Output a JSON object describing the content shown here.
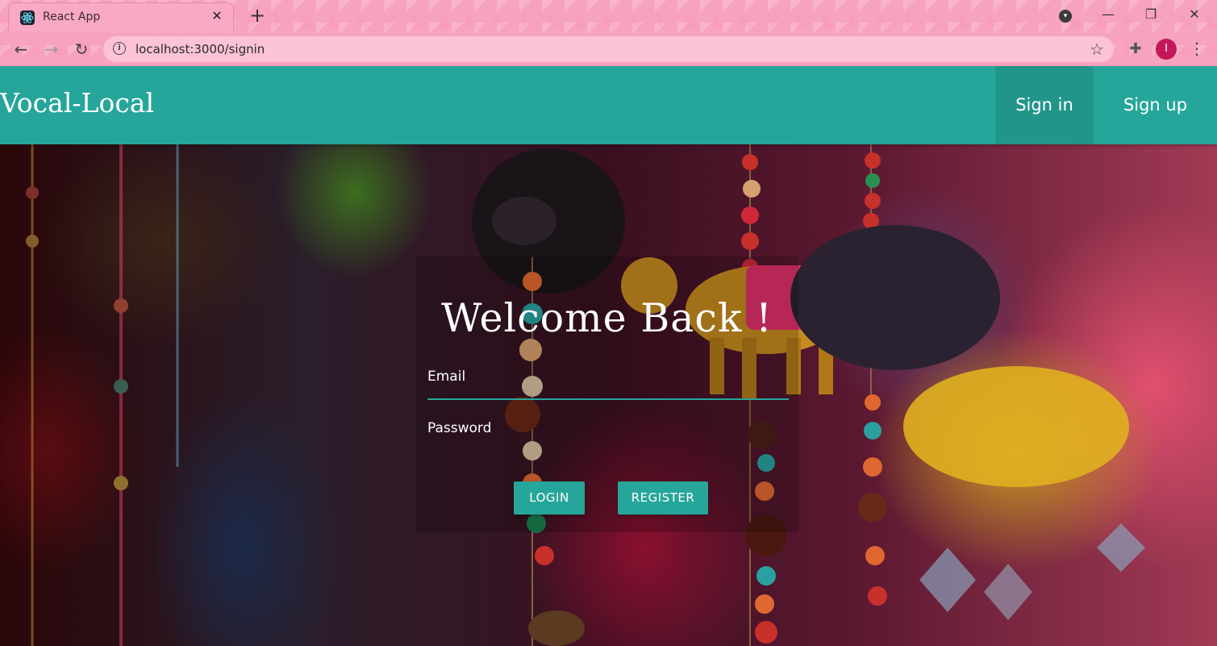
{
  "browser": {
    "tab_title": "React App",
    "tab_close": "✕",
    "new_tab": "+",
    "url": "localhost:3000/signin",
    "profile_initial": "I",
    "minimize": "—",
    "restore": "❐",
    "close": "✕"
  },
  "navbar": {
    "brand": "Vocal-Local",
    "items": [
      {
        "label": "Sign in"
      },
      {
        "label": "Sign up"
      }
    ],
    "color": "#26a69a"
  },
  "login": {
    "title": "Welcome Back !",
    "email_label": "Email",
    "password_label": "Password",
    "login_button": "LOGIN",
    "register_button": "REGISTER"
  }
}
